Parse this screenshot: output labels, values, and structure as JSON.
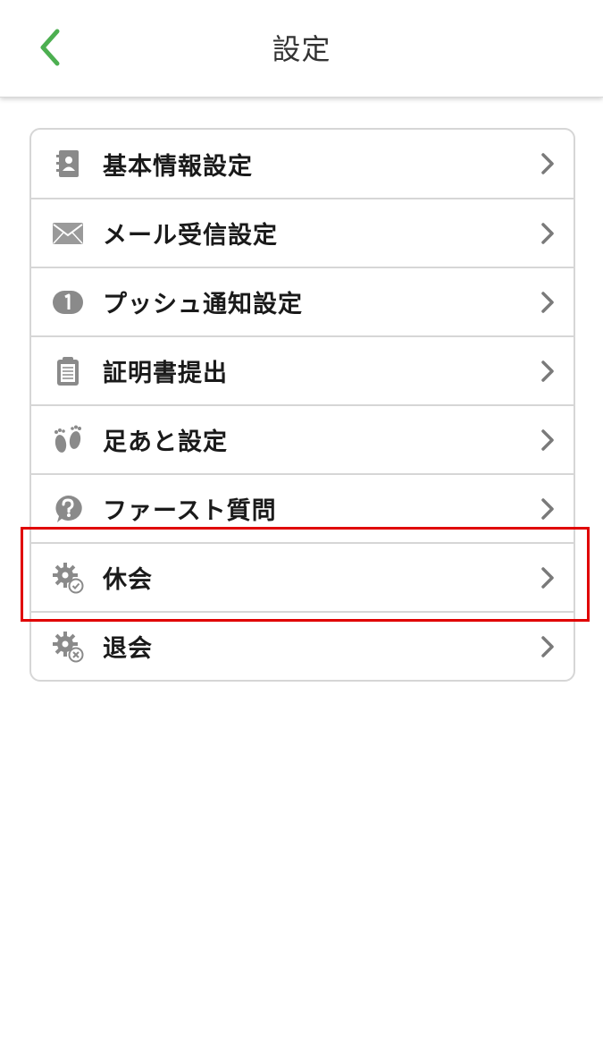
{
  "header": {
    "title": "設定",
    "back_icon": "chevron-left-icon",
    "accent_color": "#4caf50"
  },
  "menu": {
    "items": [
      {
        "label": "基本情報設定",
        "icon": "address-book-icon"
      },
      {
        "label": "メール受信設定",
        "icon": "envelope-icon"
      },
      {
        "label": "プッシュ通知設定",
        "icon": "notification-badge-icon"
      },
      {
        "label": "証明書提出",
        "icon": "clipboard-icon"
      },
      {
        "label": "足あと設定",
        "icon": "footprints-icon"
      },
      {
        "label": "ファースト質問",
        "icon": "question-bubble-icon"
      },
      {
        "label": "休会",
        "icon": "gear-check-icon"
      },
      {
        "label": "退会",
        "icon": "gear-cancel-icon"
      }
    ],
    "chevron_icon": "chevron-right-icon"
  },
  "highlight": {
    "color": "#e00000",
    "target": "休会"
  }
}
